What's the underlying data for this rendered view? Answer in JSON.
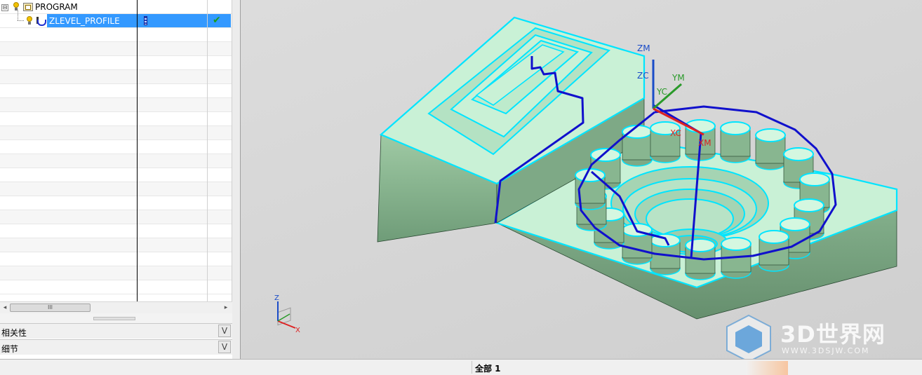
{
  "operation_navigator": {
    "rows": [
      {
        "name": "PROGRAM",
        "expander": "⊟",
        "icons": [
          "bulb-icon",
          "program-folder-icon"
        ]
      },
      {
        "name": "ZLEVEL_PROFILE",
        "selected": true,
        "icons": [
          "bulb-icon",
          "zlevel-operation-icon",
          "tool-icon",
          "check-icon"
        ],
        "status": "✔"
      }
    ],
    "empty_row_count": 19,
    "selection_color": "#3399ff"
  },
  "scrollbar": {
    "left_arrow": "◂",
    "right_arrow": "▸",
    "thumb_grip": "III"
  },
  "panels": [
    {
      "label": "相关性",
      "chevron": "V"
    },
    {
      "label": "细节",
      "chevron": "V"
    }
  ],
  "viewport": {
    "wcs_labels": {
      "zm": "ZM",
      "zc": "ZC",
      "ym": "YM",
      "yc": "YC",
      "xc": "XC",
      "xm": "XM"
    },
    "triad_labels": {
      "z": "Z",
      "x": "X"
    },
    "colors": {
      "model_body": "#8dba92",
      "model_top": "#c8f0d6",
      "edges": "#00ffff",
      "toolpath": "#1010cc",
      "x_axis": "#dd2222",
      "y_axis": "#2a9a2a",
      "z_axis": "#1a4cc8"
    }
  },
  "status_bar": {
    "selection_filter": "全部 1"
  },
  "watermark": {
    "text": "3D世界网",
    "url": "WWW.3DSJW.COM"
  }
}
